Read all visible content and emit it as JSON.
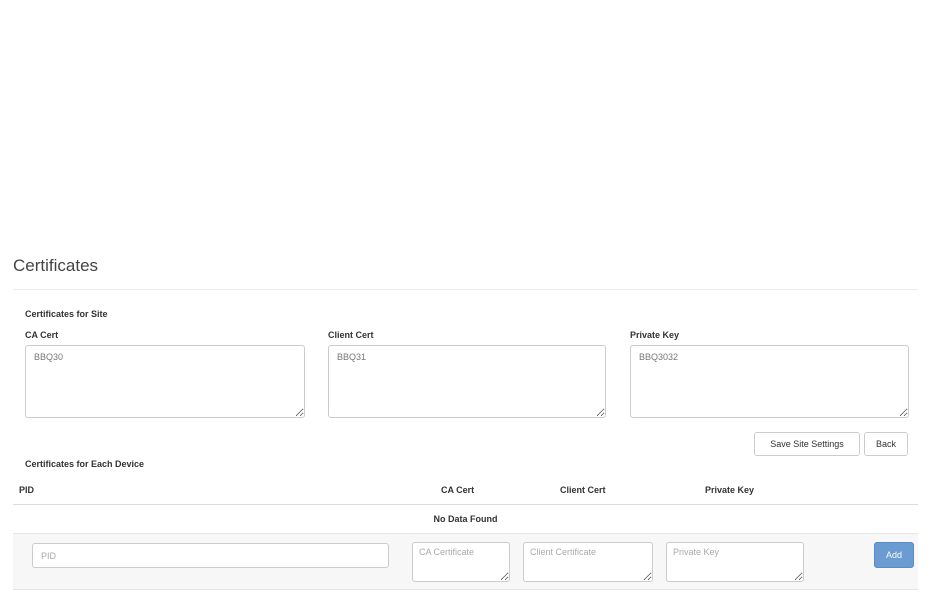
{
  "page": {
    "title": "Certificates"
  },
  "site_section": {
    "heading": "Certificates for Site",
    "ca_cert": {
      "label": "CA Cert",
      "value": "BBQ30"
    },
    "client_cert": {
      "label": "Client Cert",
      "value": "BBQ31"
    },
    "private_key": {
      "label": "Private Key",
      "value": "BBQ3032"
    },
    "save_label": "Save Site Settings",
    "back_label": "Back"
  },
  "device_section": {
    "heading": "Certificates for Each Device",
    "columns": [
      "PID",
      "CA Cert",
      "Client Cert",
      "Private Key"
    ],
    "empty_text": "No Data Found",
    "new_row": {
      "pid_placeholder": "PID",
      "ca_placeholder": "CA Certificate",
      "client_placeholder": "Client Certificate",
      "key_placeholder": "Private Key",
      "add_label": "Add"
    }
  },
  "colors": {
    "primary_button": "#6a9bd1",
    "row_background": "#f7f7f7"
  }
}
